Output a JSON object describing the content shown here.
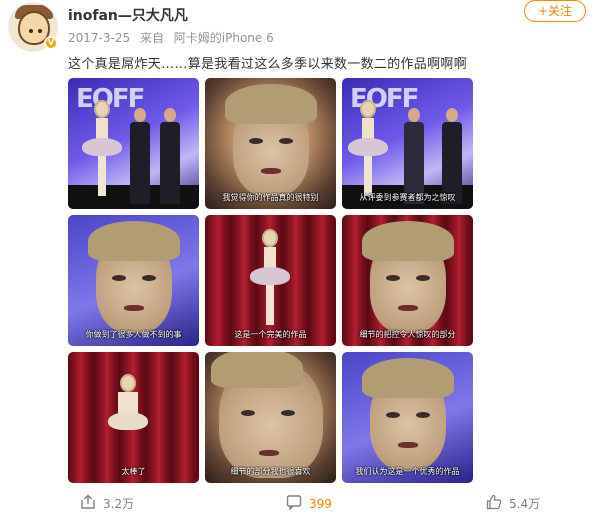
{
  "header": {
    "username": "inofan—只大凡凡",
    "date": "2017-3-25",
    "source_prefix": "来自",
    "source": "阿卡姆的iPhone 6",
    "follow_label": "+关注",
    "verified_badge": "V"
  },
  "post": {
    "text": "这个真是屌炸天……算是我看过这么多季以来数一数二的作品啊啊啊"
  },
  "photos": [
    {
      "scene": "stage-lineup-with-doll",
      "caption": ""
    },
    {
      "scene": "doll-face-closeup",
      "caption": "我觉得你的作品真的很特别"
    },
    {
      "scene": "stage-lineup-with-doll",
      "caption": "从评委到参赛者都为之惊叹"
    },
    {
      "scene": "doll-face-closeup",
      "caption": "你做到了很多人做不到的事"
    },
    {
      "scene": "doll-full-body-curtain",
      "caption": "这是一个完美的作品"
    },
    {
      "scene": "doll-face-curtain",
      "caption": "细节的把控令人惊叹的部分"
    },
    {
      "scene": "doll-seated-curtain",
      "caption": "太棒了"
    },
    {
      "scene": "doll-eye-closeup",
      "caption": "细节的部分我也很喜欢"
    },
    {
      "scene": "doll-face-purple",
      "caption": "我们认为这是一个优秀的作品"
    }
  ],
  "actions": {
    "share_count": "3.2万",
    "comment_count": "399",
    "like_count": "5.4万"
  },
  "colors": {
    "accent": "#ff8200",
    "text": "#333333",
    "meta": "#939393"
  }
}
